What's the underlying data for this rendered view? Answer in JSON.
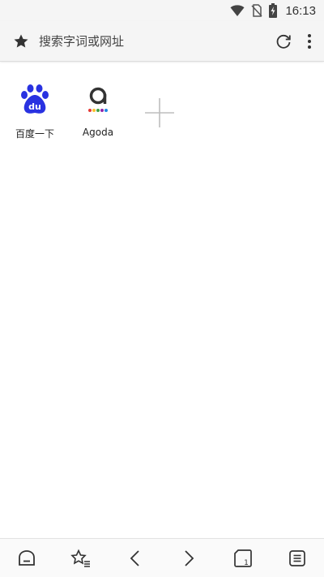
{
  "status_bar": {
    "time": "16:13"
  },
  "address_bar": {
    "search_placeholder": "搜索字词或网址"
  },
  "speed_dial": {
    "tiles": [
      {
        "label": "百度一下",
        "icon": "baidu-paw-icon",
        "color": "#2932e1"
      },
      {
        "label": "Agoda",
        "icon": "agoda-logo-icon",
        "color": "#333333"
      }
    ],
    "add_icon": "plus-icon"
  },
  "bottom_bar": {
    "icons": [
      "home-icon",
      "bookmarks-icon",
      "back-icon",
      "forward-icon",
      "tabs-icon",
      "menu-list-icon"
    ],
    "tab_count": "1"
  },
  "colors": {
    "bar_background": "#f5f5f5",
    "icon_dark": "#333333",
    "baidu_blue": "#2932e1",
    "add_gray": "#bdbdbd"
  }
}
